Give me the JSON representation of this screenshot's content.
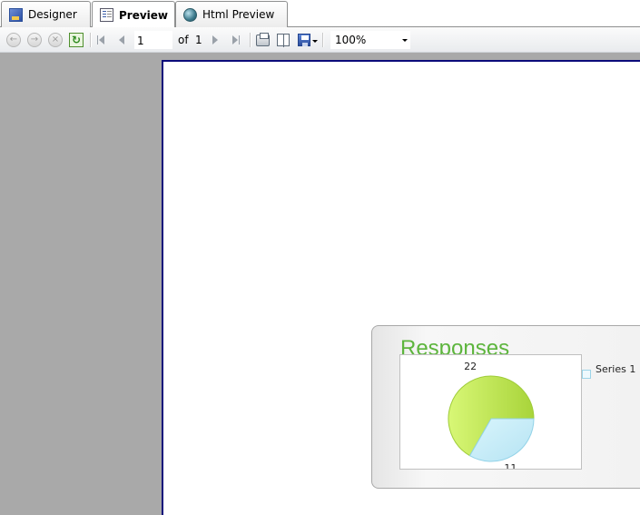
{
  "tabs": [
    {
      "label": "Designer",
      "icon": "designer-icon",
      "active": false
    },
    {
      "label": "Preview",
      "icon": "report-preview-icon",
      "active": true
    },
    {
      "label": "Html Preview",
      "icon": "globe-icon",
      "active": false
    }
  ],
  "toolbar": {
    "page_current": "1",
    "of_label": "of",
    "page_total": "1",
    "zoom": "100%"
  },
  "colors": {
    "viewer_background": "#a9a9a9",
    "page_border": "#0b0b7a",
    "title": "#5db53d",
    "slice_green": "#b5e04a",
    "slice_blue": "#c6ecf8"
  },
  "chart": {
    "title": "Responses",
    "legend_label": "Series 1"
  },
  "chart_data": {
    "type": "pie",
    "title": "Responses",
    "series": [
      {
        "name": "Series 1",
        "values": [
          22,
          11
        ]
      }
    ],
    "data_labels": [
      "22",
      "11"
    ],
    "legend": [
      "Series 1"
    ],
    "legend_position": "right"
  }
}
